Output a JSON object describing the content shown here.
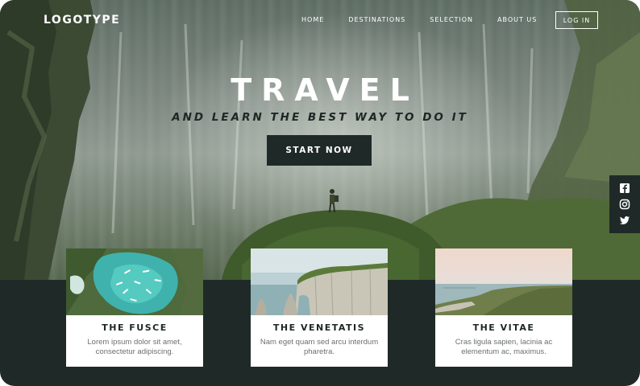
{
  "header": {
    "logo": "LOGOTYPE",
    "nav": [
      "HOME",
      "DESTINATIONS",
      "SELECTION",
      "ABOUT US"
    ],
    "login_label": "LOG IN"
  },
  "hero": {
    "title": "TRAVEL",
    "subtitle": "AND LEARN THE BEST WAY TO DO IT",
    "cta_label": "START NOW"
  },
  "social": {
    "icons": [
      "facebook-icon",
      "instagram-icon",
      "twitter-icon"
    ]
  },
  "cards": [
    {
      "title": "THE FUSCE",
      "text": "Lorem ipsum dolor sit amet, consectetur adipiscing."
    },
    {
      "title": "THE VENETATIS",
      "text": "Nam eget quam sed arcu interdum pharetra."
    },
    {
      "title": "THE VITAE",
      "text": "Cras ligula sapien, lacinia ac elementum ac, maximus."
    }
  ],
  "colors": {
    "dark": "#1f2a28",
    "white": "#ffffff",
    "text_gray": "#6c706f"
  }
}
